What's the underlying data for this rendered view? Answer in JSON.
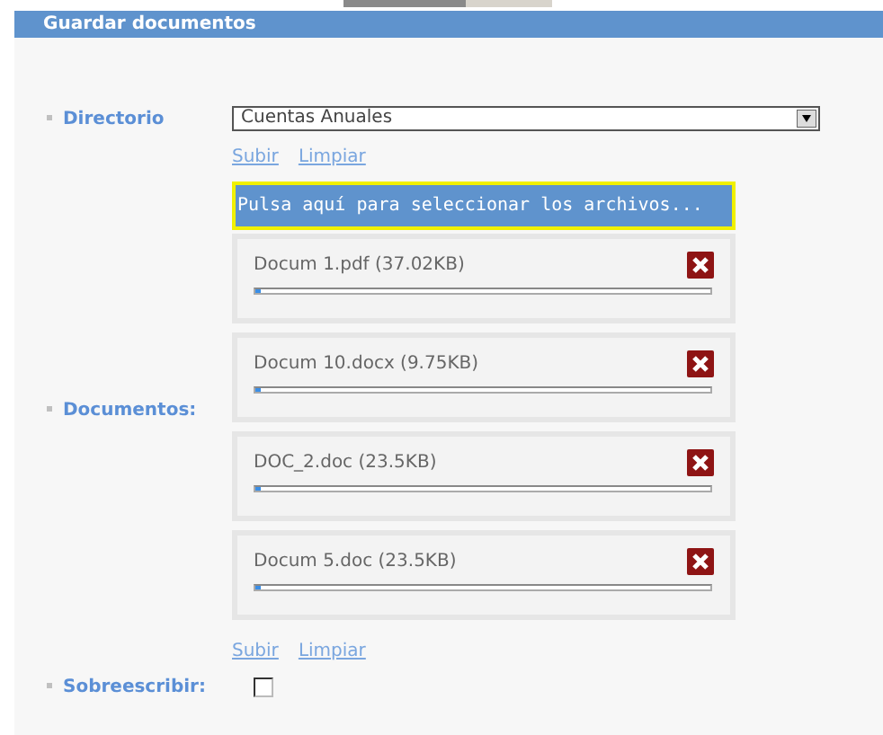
{
  "panel": {
    "title": "Guardar documentos"
  },
  "directory": {
    "label": "Directorio",
    "value": "Cuentas Anuales",
    "links": [
      "Subir",
      "Limpiar"
    ]
  },
  "documents": {
    "label": "Documentos:",
    "select_button": "Pulsa aquí para seleccionar los archivos...",
    "files": [
      {
        "name": "Docum 1.pdf (37.02KB)",
        "level": 0.01
      },
      {
        "name": "Docum 10.docx (9.75KB)",
        "level": 0.01
      },
      {
        "name": "DOC_2.doc (23.5KB)",
        "level": 0.01
      },
      {
        "name": "Docum 5.doc (23.5KB)",
        "level": 0.01
      }
    ],
    "links": [
      "Subir",
      "Limpiar"
    ]
  },
  "overwrite": {
    "label": "Sobreescribir:",
    "checked": false
  }
}
